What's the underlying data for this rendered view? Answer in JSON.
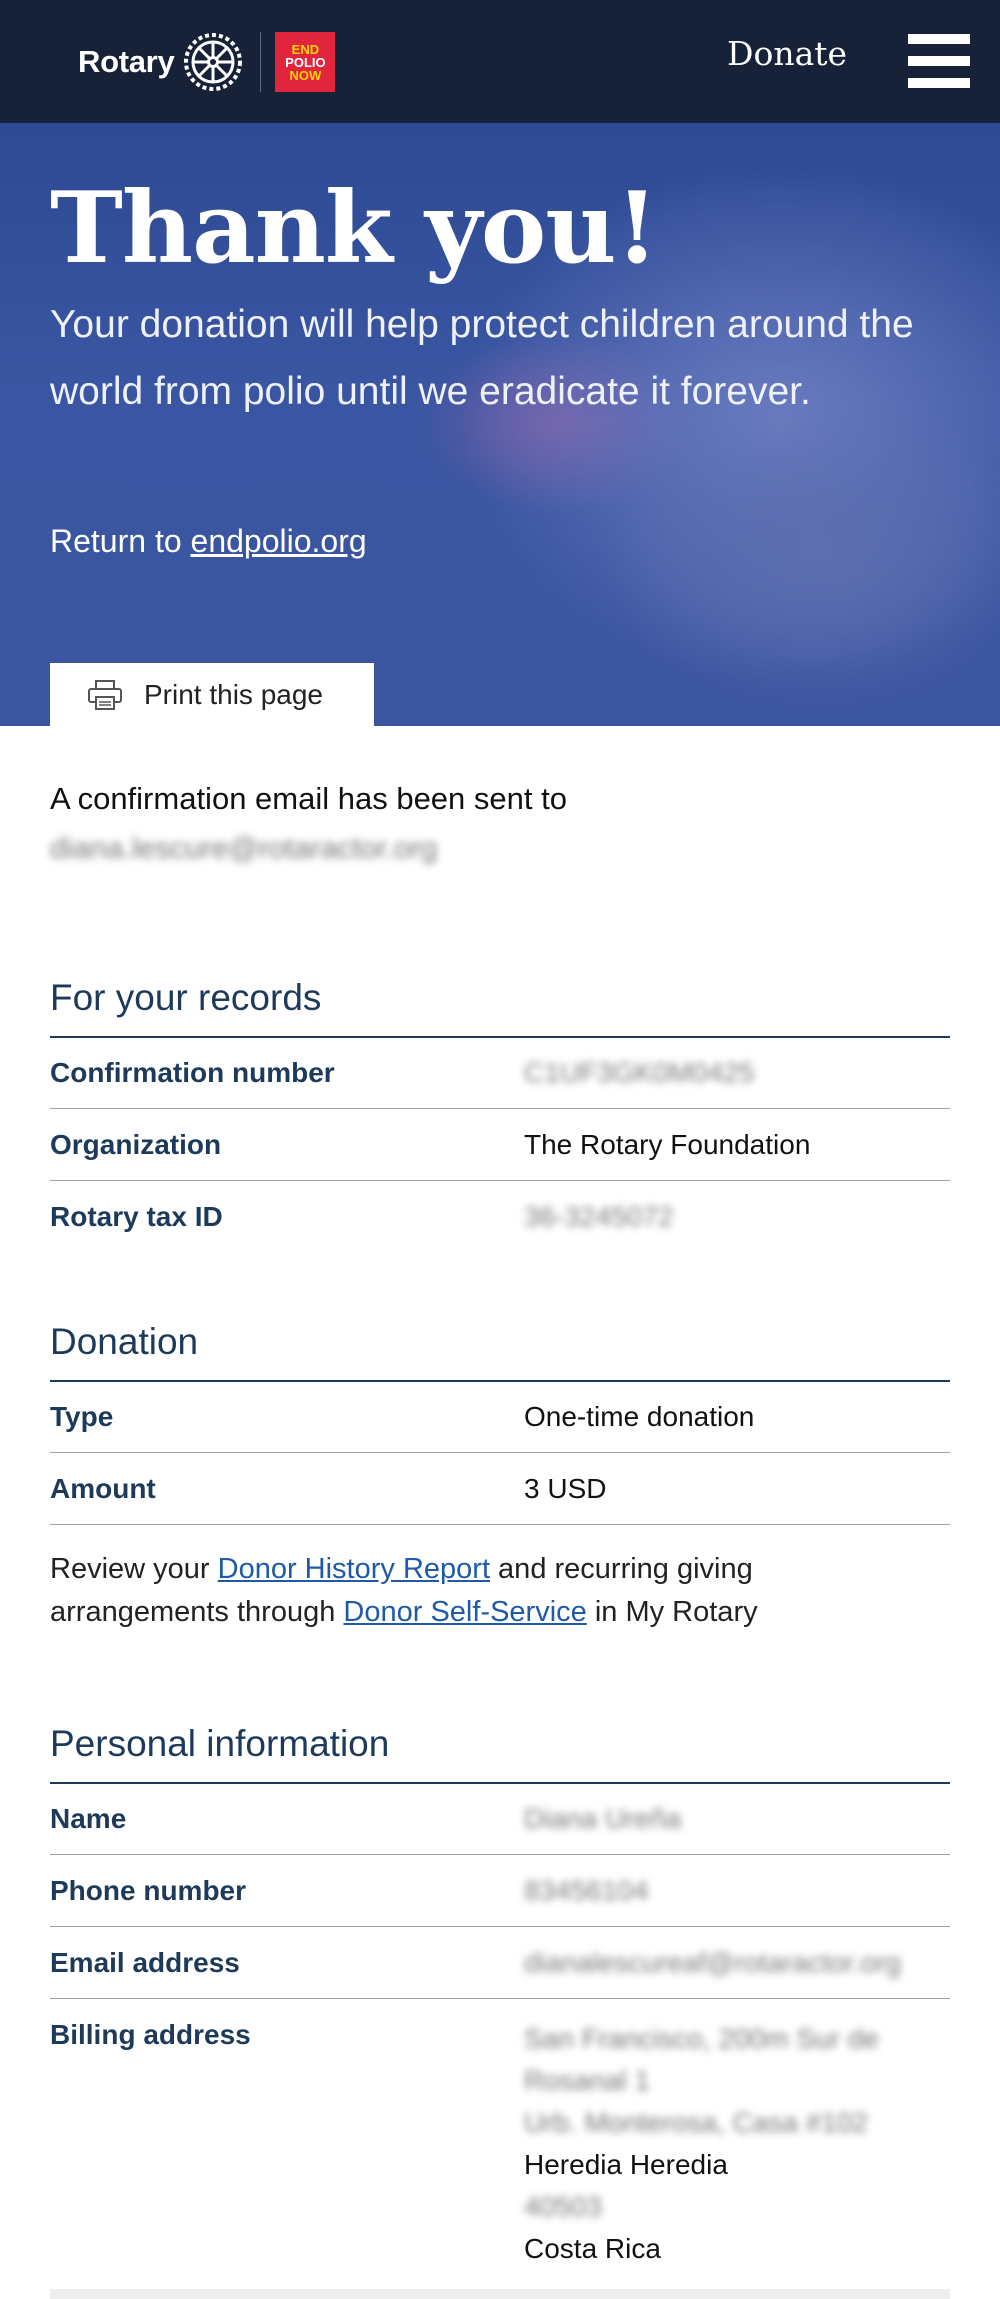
{
  "header": {
    "logo_text": "Rotary",
    "end_polio_badge": [
      "END",
      "POLIO",
      "NOW"
    ],
    "donate_label": "Donate",
    "menu_icon": "hamburger-menu-icon"
  },
  "hero": {
    "title": "Thank you!",
    "subtitle": "Your donation will help protect children around the world from polio until we eradicate it forever.",
    "return_prefix": "Return to ",
    "return_link": "endpolio.org",
    "print_icon": "printer-icon",
    "print_label": "Print this page"
  },
  "confirmation": {
    "text": "A confirmation email has been sent to",
    "email_blurred": "diana.lescure@rotaractor.org"
  },
  "records": {
    "title": "For your records",
    "rows": [
      {
        "label": "Confirmation number",
        "value": "C1UF3GK0M0425",
        "blurred": true
      },
      {
        "label": "Organization",
        "value": "The Rotary Foundation",
        "blurred": false
      },
      {
        "label": "Rotary tax ID",
        "value": "36-3245072",
        "blurred": true
      }
    ]
  },
  "donation": {
    "title": "Donation",
    "rows": [
      {
        "label": "Type",
        "value": "One-time donation"
      },
      {
        "label": "Amount",
        "value": "3 USD"
      }
    ],
    "review_prefix": "Review your ",
    "donor_history_link": "Donor History Report",
    "review_middle": " and recurring giving arrangements through ",
    "self_service_link": "Donor Self-Service",
    "review_suffix": " in My Rotary"
  },
  "personal": {
    "title": "Personal information",
    "rows": [
      {
        "label": "Name",
        "value": "Diana Ureña",
        "blurred": true
      },
      {
        "label": "Phone number",
        "value": "83456104",
        "blurred": true
      },
      {
        "label": "Email address",
        "value": "dianalescureaf@rotaractor.org",
        "blurred": true
      }
    ],
    "billing_label": "Billing address",
    "billing_lines": [
      {
        "text": "San Francisco, 200m Sur de",
        "blurred": true
      },
      {
        "text": "Rosanal 1",
        "blurred": true
      },
      {
        "text": "Urb. Monterosa, Casa #102",
        "blurred": true
      },
      {
        "text": "Heredia Heredia",
        "blurred": false
      },
      {
        "text": "40503",
        "blurred": true
      },
      {
        "text": "Costa Rica",
        "blurred": false
      }
    ]
  }
}
